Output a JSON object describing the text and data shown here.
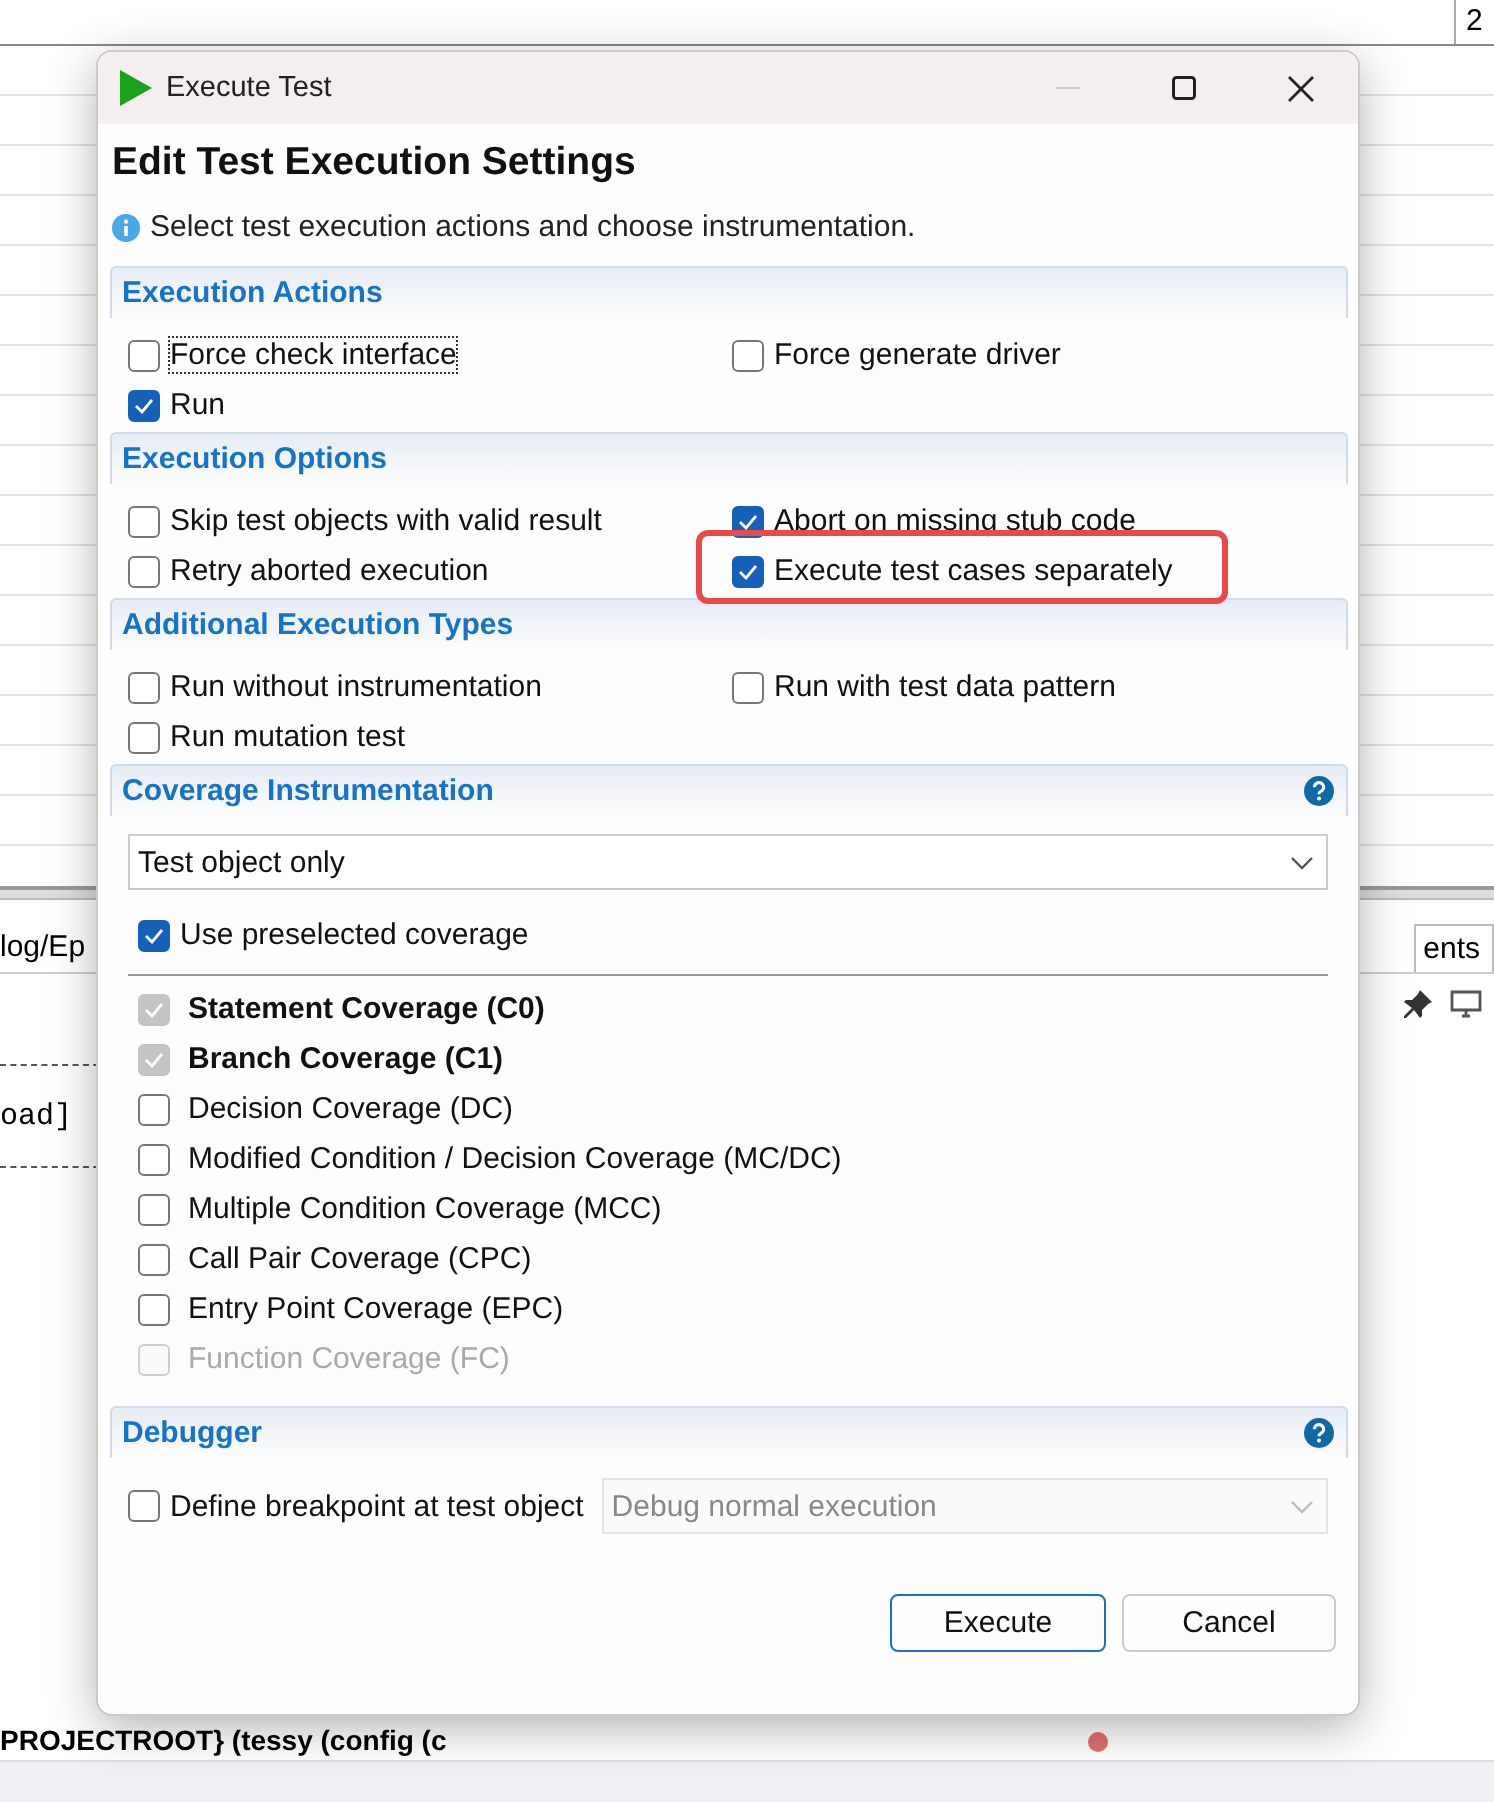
{
  "background": {
    "top_field": "2",
    "tab_left": "log/Ep",
    "tab_right": "ents",
    "code_line": "oad]",
    "status_text": "PROJECTROOT} (tessy (config (c"
  },
  "dialog": {
    "title": "Execute Test",
    "heading": "Edit Test Execution Settings",
    "info": "Select test execution actions and choose instrumentation.",
    "sections": [
      {
        "kind": "checks",
        "title": "Execution Actions",
        "options": [
          {
            "label": "Force check interface",
            "checked": false,
            "focused": true,
            "highlighted": false
          },
          {
            "label": "Force generate driver",
            "checked": false,
            "focused": false,
            "highlighted": false
          },
          {
            "label": "Run",
            "checked": true,
            "focused": false,
            "highlighted": false
          }
        ]
      },
      {
        "kind": "checks",
        "title": "Execution Options",
        "options": [
          {
            "label": "Skip test objects with valid result",
            "checked": false,
            "focused": false,
            "highlighted": false
          },
          {
            "label": "Abort on missing stub code",
            "checked": true,
            "focused": false,
            "highlighted": false
          },
          {
            "label": "Retry aborted execution",
            "checked": false,
            "focused": false,
            "highlighted": false
          },
          {
            "label": "Execute test cases separately",
            "checked": true,
            "focused": false,
            "highlighted": true
          }
        ]
      },
      {
        "kind": "checks",
        "title": "Additional Execution Types",
        "options": [
          {
            "label": "Run without instrumentation",
            "checked": false,
            "focused": false,
            "highlighted": false
          },
          {
            "label": "Run with test data pattern",
            "checked": false,
            "focused": false,
            "highlighted": false
          },
          {
            "label": "Run mutation test",
            "checked": false,
            "focused": false,
            "highlighted": false
          }
        ]
      },
      {
        "kind": "coverage",
        "title": "Coverage Instrumentation",
        "help": true,
        "dropdown": {
          "value": "Test object only",
          "disabled": false
        },
        "preselected": {
          "label": "Use preselected coverage",
          "checked": true
        },
        "items": [
          {
            "label": "Statement Coverage (C0)",
            "checked": true,
            "disabled": true,
            "bold": true
          },
          {
            "label": "Branch Coverage (C1)",
            "checked": true,
            "disabled": true,
            "bold": true
          },
          {
            "label": "Decision Coverage (DC)",
            "checked": false,
            "disabled": false,
            "bold": false
          },
          {
            "label": "Modified Condition / Decision Coverage (MC/DC)",
            "checked": false,
            "disabled": false,
            "bold": false
          },
          {
            "label": "Multiple Condition Coverage (MCC)",
            "checked": false,
            "disabled": false,
            "bold": false
          },
          {
            "label": "Call Pair Coverage (CPC)",
            "checked": false,
            "disabled": false,
            "bold": false
          },
          {
            "label": "Entry Point Coverage (EPC)",
            "checked": false,
            "disabled": false,
            "bold": false
          },
          {
            "label": "Function Coverage (FC)",
            "checked": false,
            "disabled": true,
            "bold": false
          }
        ]
      },
      {
        "kind": "debugger",
        "title": "Debugger",
        "help": true,
        "option": {
          "label": "Define breakpoint at test object",
          "checked": false
        },
        "dropdown": {
          "value": "Debug normal execution",
          "disabled": true
        }
      }
    ],
    "buttons": [
      {
        "label": "Execute",
        "default": true
      },
      {
        "label": "Cancel",
        "default": false
      }
    ]
  }
}
